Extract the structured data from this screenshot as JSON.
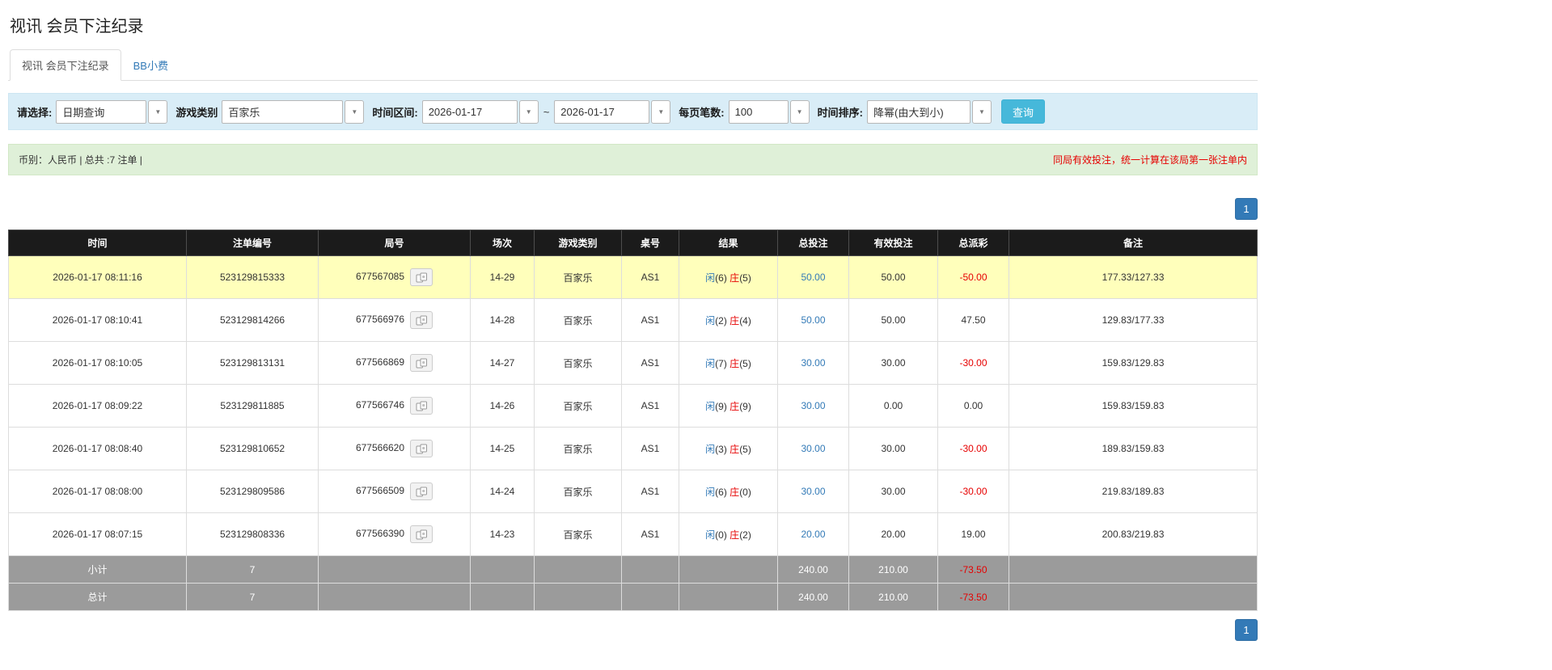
{
  "colors": {
    "accent_blue": "#337ab7",
    "search_button_blue": "#46b8da",
    "table_header_bg": "#1b1b1b",
    "highlight_yellow": "#ffffbb",
    "filter_bar_bg": "#d9edf7",
    "summary_bar_bg": "#dff0d8",
    "negative_red": "#e60000",
    "footer_gray": "#9b9b9b"
  },
  "page": {
    "title": "视讯 会员下注纪录"
  },
  "tabs": [
    {
      "label": "视讯 会员下注纪录",
      "active": true
    },
    {
      "label": "BB小费",
      "active": false
    }
  ],
  "filters": {
    "select_label": "请选择:",
    "select_value": "日期查询",
    "game_type_label": "游戏类别",
    "game_type_value": "百家乐",
    "date_range_label": "时间区间:",
    "date_from": "2026-01-17",
    "range_separator": "~",
    "date_to": "2026-01-17",
    "page_size_label": "每页笔数:",
    "page_size_value": "100",
    "sort_label": "时间排序:",
    "sort_value": "降幂(由大到小)",
    "search_button": "查询",
    "caret_icon": "▼"
  },
  "summary": {
    "left": "币别：人民币 | 总共 :7 注单 |",
    "right": "同局有效投注，统一计算在该局第一张注单内"
  },
  "pagination": {
    "page": "1"
  },
  "table": {
    "headers": [
      "时间",
      "注单编号",
      "局号",
      "场次",
      "游戏类别",
      "桌号",
      "结果",
      "总投注",
      "有效投注",
      "总派彩",
      "备注"
    ],
    "rows": [
      {
        "time": "2026-01-17 08:11:16",
        "bet_id": "523129815333",
        "round_id": "677567085",
        "session": "14-29",
        "game": "百家乐",
        "table_no": "AS1",
        "result": {
          "player": "闲",
          "player_score": "(6)",
          "banker": "庄",
          "banker_score": "(5)"
        },
        "total_bet": "50.00",
        "valid_bet": "50.00",
        "payout": "-50.00",
        "note": "177.33/127.33",
        "highlight": true
      },
      {
        "time": "2026-01-17 08:10:41",
        "bet_id": "523129814266",
        "round_id": "677566976",
        "session": "14-28",
        "game": "百家乐",
        "table_no": "AS1",
        "result": {
          "player": "闲",
          "player_score": "(2)",
          "banker": "庄",
          "banker_score": "(4)"
        },
        "total_bet": "50.00",
        "valid_bet": "50.00",
        "payout": "47.50",
        "note": "129.83/177.33",
        "highlight": false
      },
      {
        "time": "2026-01-17 08:10:05",
        "bet_id": "523129813131",
        "round_id": "677566869",
        "session": "14-27",
        "game": "百家乐",
        "table_no": "AS1",
        "result": {
          "player": "闲",
          "player_score": "(7)",
          "banker": "庄",
          "banker_score": "(5)"
        },
        "total_bet": "30.00",
        "valid_bet": "30.00",
        "payout": "-30.00",
        "note": "159.83/129.83",
        "highlight": false
      },
      {
        "time": "2026-01-17 08:09:22",
        "bet_id": "523129811885",
        "round_id": "677566746",
        "session": "14-26",
        "game": "百家乐",
        "table_no": "AS1",
        "result": {
          "player": "闲",
          "player_score": "(9)",
          "banker": "庄",
          "banker_score": "(9)"
        },
        "total_bet": "30.00",
        "valid_bet": "0.00",
        "payout": "0.00",
        "note": "159.83/159.83",
        "highlight": false
      },
      {
        "time": "2026-01-17 08:08:40",
        "bet_id": "523129810652",
        "round_id": "677566620",
        "session": "14-25",
        "game": "百家乐",
        "table_no": "AS1",
        "result": {
          "player": "闲",
          "player_score": "(3)",
          "banker": "庄",
          "banker_score": "(5)"
        },
        "total_bet": "30.00",
        "valid_bet": "30.00",
        "payout": "-30.00",
        "note": "189.83/159.83",
        "highlight": false
      },
      {
        "time": "2026-01-17 08:08:00",
        "bet_id": "523129809586",
        "round_id": "677566509",
        "session": "14-24",
        "game": "百家乐",
        "table_no": "AS1",
        "result": {
          "player": "闲",
          "player_score": "(6)",
          "banker": "庄",
          "banker_score": "(0)"
        },
        "total_bet": "30.00",
        "valid_bet": "30.00",
        "payout": "-30.00",
        "note": "219.83/189.83",
        "highlight": false
      },
      {
        "time": "2026-01-17 08:07:15",
        "bet_id": "523129808336",
        "round_id": "677566390",
        "session": "14-23",
        "game": "百家乐",
        "table_no": "AS1",
        "result": {
          "player": "闲",
          "player_score": "(0)",
          "banker": "庄",
          "banker_score": "(2)"
        },
        "total_bet": "20.00",
        "valid_bet": "20.00",
        "payout": "19.00",
        "note": "200.83/219.83",
        "highlight": false
      }
    ],
    "subtotal": {
      "label": "小计",
      "count": "7",
      "total_bet": "240.00",
      "valid_bet": "210.00",
      "payout": "-73.50"
    },
    "total": {
      "label": "总计",
      "count": "7",
      "total_bet": "240.00",
      "valid_bet": "210.00",
      "payout": "-73.50"
    }
  }
}
